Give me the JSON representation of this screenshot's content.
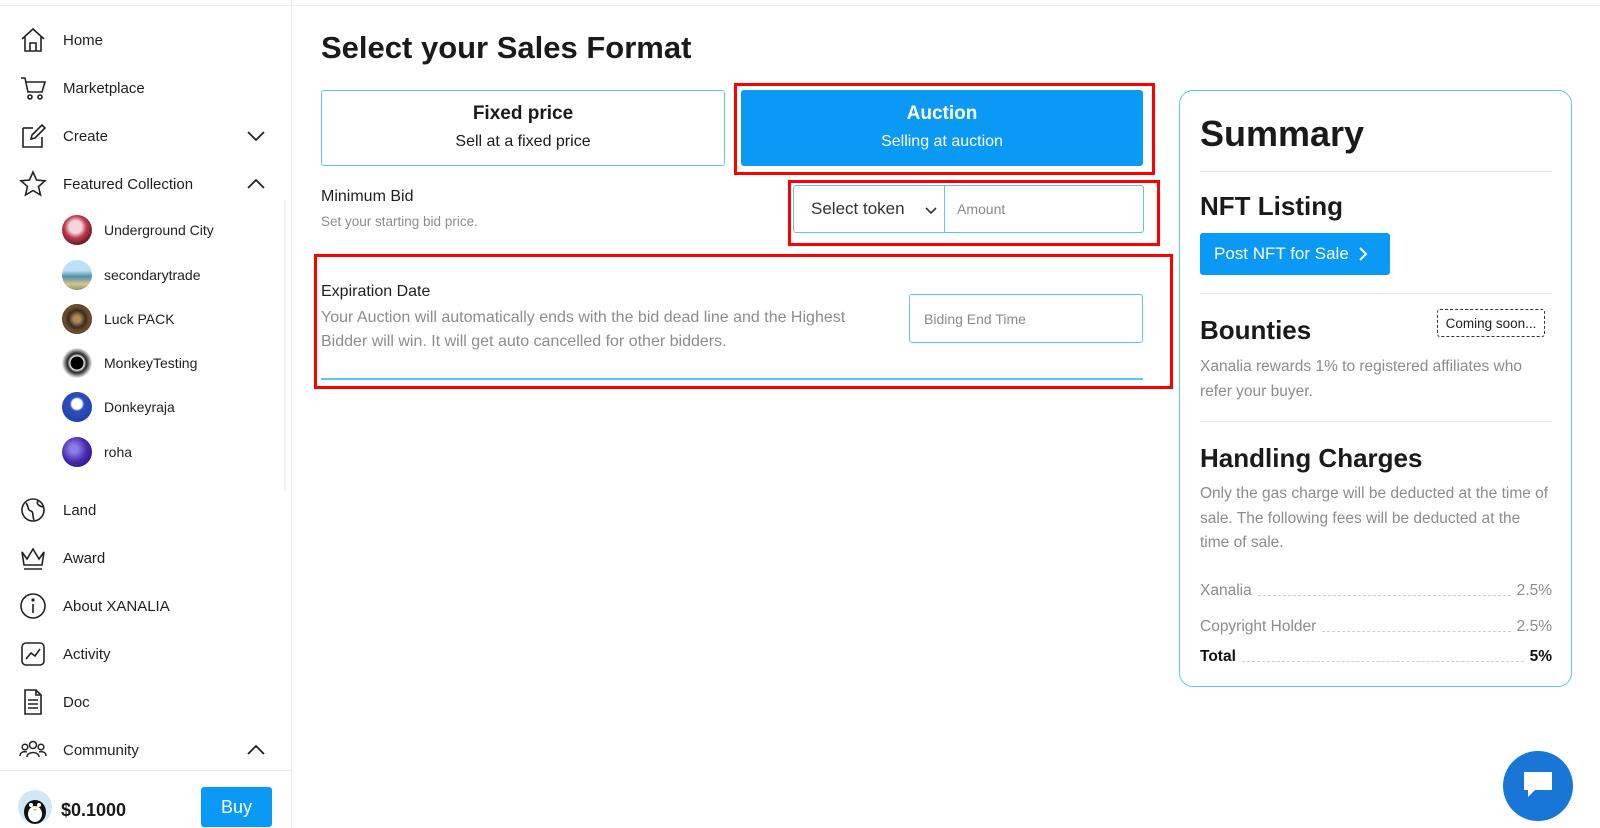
{
  "sidebar": {
    "items": [
      {
        "label": "Home",
        "icon": "home-icon"
      },
      {
        "label": "Marketplace",
        "icon": "cart-icon"
      },
      {
        "label": "Create",
        "icon": "edit-icon"
      },
      {
        "label": "Featured Collection",
        "icon": "star-icon"
      },
      {
        "label": "Land",
        "icon": "globe-icon"
      },
      {
        "label": "Award",
        "icon": "crown-icon"
      },
      {
        "label": "About XANALIA",
        "icon": "info-icon"
      },
      {
        "label": "Activity",
        "icon": "activity-icon"
      },
      {
        "label": "Doc",
        "icon": "document-icon"
      },
      {
        "label": "Community",
        "icon": "community-icon"
      }
    ],
    "collections": [
      {
        "label": "Underground City"
      },
      {
        "label": "secondarytrade"
      },
      {
        "label": "Luck PACK"
      },
      {
        "label": "MonkeyTesting"
      },
      {
        "label": "Donkeyraja"
      },
      {
        "label": "roha"
      }
    ],
    "footer": {
      "price": "$0.1000",
      "buy_label": "Buy"
    }
  },
  "main": {
    "title": "Select your Sales Format",
    "formats": [
      {
        "title": "Fixed price",
        "subtitle": "Sell at a fixed price"
      },
      {
        "title": "Auction",
        "subtitle": "Selling at auction",
        "selected": true
      }
    ],
    "min_bid": {
      "title": "Minimum Bid",
      "description": "Set your starting bid price.",
      "token_value": "Select token",
      "amount_placeholder": "Amount"
    },
    "expiration": {
      "title": "Expiration Date",
      "description": "Your Auction will automatically ends with the bid dead line and the Highest Bidder will win. It will get auto cancelled for other bidders.",
      "end_placeholder": "Biding End Time"
    }
  },
  "summary": {
    "title": "Summary",
    "nft_listing": {
      "title": "NFT Listing",
      "button_label": "Post NFT for Sale"
    },
    "bounties": {
      "title": "Bounties",
      "badge": "Coming soon...",
      "description": "Xanalia rewards 1% to registered affiliates who refer your buyer."
    },
    "handling": {
      "title": "Handling Charges",
      "description": "Only the gas charge will be deducted at the time of sale. The following fees will be deducted at the time of sale.",
      "fees": [
        {
          "name": "Xanalia",
          "value": "2.5%"
        },
        {
          "name": "Copyright Holder",
          "value": "2.5%"
        }
      ],
      "total": {
        "name": "Total",
        "value": "5%"
      }
    }
  },
  "colors": {
    "accent": "#0a99f5",
    "border": "#5bc4f8",
    "highlight": "#ff0000",
    "chat": "#1877d6"
  }
}
